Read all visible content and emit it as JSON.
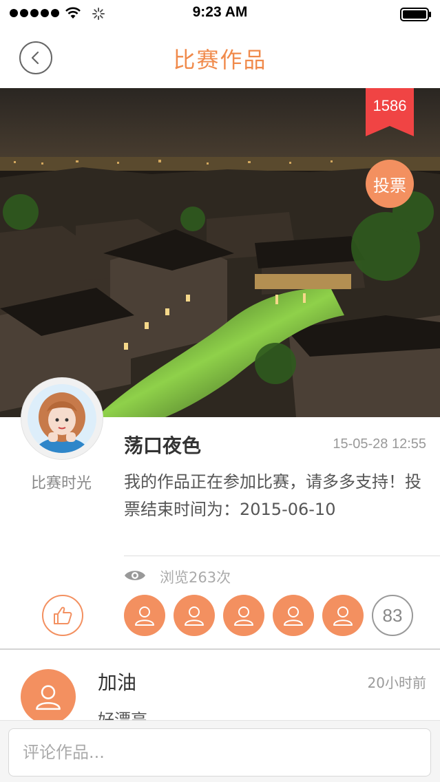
{
  "status_bar": {
    "time": "9:23 AM"
  },
  "nav": {
    "title": "比赛作品",
    "back_icon": "chevron-left-icon"
  },
  "hero": {
    "vote_count": "1586",
    "vote_label": "投票"
  },
  "post": {
    "author_name": "比赛时光",
    "title": "荡口夜色",
    "timestamp": "15-05-28 12:55",
    "body": "我的作品正在参加比赛，请多多支持！投票结束时间为：2015-06-10",
    "views": "浏览263次",
    "like_icon": "thumbs-up-icon",
    "likers_extra_count": "83"
  },
  "comments": [
    {
      "name": "加油",
      "time": "20小时前",
      "text": "好漂亮。"
    }
  ],
  "comment_input": {
    "placeholder": "评论作品..."
  },
  "colors": {
    "accent": "#f39060",
    "title": "#f08a4b",
    "ribbon": "#f04444"
  }
}
